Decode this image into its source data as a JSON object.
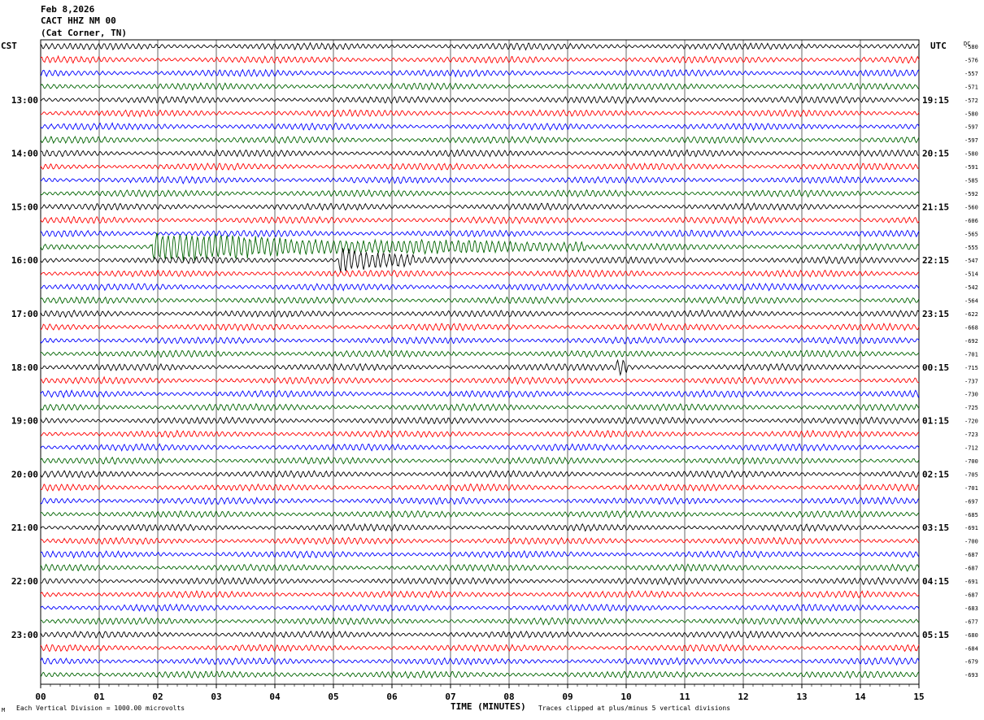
{
  "header": {
    "date": "Feb 8,2026",
    "station": "CACT HHZ NM 00",
    "location": "(Cat Corner, TN)"
  },
  "tz_left": "CST",
  "tz_right": "UTC",
  "dc_label": "DC",
  "footer": {
    "left": "Each Vertical Division = 1000.00 microvolts",
    "right": "Traces clipped at plus/minus 5 vertical divisions",
    "corner": "M"
  },
  "chart_data": {
    "type": "line",
    "subtype": "helicorder",
    "xlabel": "TIME (MINUTES)",
    "x_ticks": [
      "00",
      "01",
      "02",
      "03",
      "04",
      "05",
      "06",
      "07",
      "08",
      "09",
      "10",
      "11",
      "12",
      "13",
      "14",
      "15"
    ],
    "xlim": [
      0,
      15
    ],
    "trace_colors": [
      "#000000",
      "#ff0000",
      "#0000ff",
      "#006400"
    ],
    "grid": "vertical every minute",
    "left_hour_labels": [
      "13:00",
      "14:00",
      "15:00",
      "16:00",
      "17:00",
      "18:00",
      "19:00",
      "20:00",
      "21:00",
      "22:00",
      "23:00"
    ],
    "right_hour_labels": [
      "19:15",
      "20:15",
      "21:15",
      "22:15",
      "23:15",
      "00:15",
      "01:15",
      "02:15",
      "03:15",
      "04:15",
      "05:15"
    ],
    "hour_label_first_row": 4,
    "hour_label_row_step": 4,
    "dc_offsets": [
      -580,
      -576,
      -557,
      -571,
      -572,
      -580,
      -597,
      -597,
      -580,
      -591,
      -585,
      -592,
      -560,
      -606,
      -565,
      -555,
      -547,
      -514,
      -542,
      -564,
      -622,
      -668,
      -692,
      -701,
      -715,
      -737,
      -730,
      -725,
      -720,
      -723,
      -712,
      -700,
      -705,
      -701,
      -697,
      -685,
      -691,
      -700,
      -687,
      -687,
      -691,
      -687,
      -683,
      -677,
      -680,
      -684,
      -679,
      -693
    ],
    "events": [
      {
        "row": 15,
        "start_min": 1.9,
        "end_min": 9.3,
        "amplitude": "large",
        "description_visible": false
      },
      {
        "row": 16,
        "start_min": 5.1,
        "end_min": 6.4,
        "amplitude": "large"
      },
      {
        "row": 24,
        "start_min": 9.8,
        "end_min": 10.05,
        "amplitude": "spike"
      }
    ]
  }
}
